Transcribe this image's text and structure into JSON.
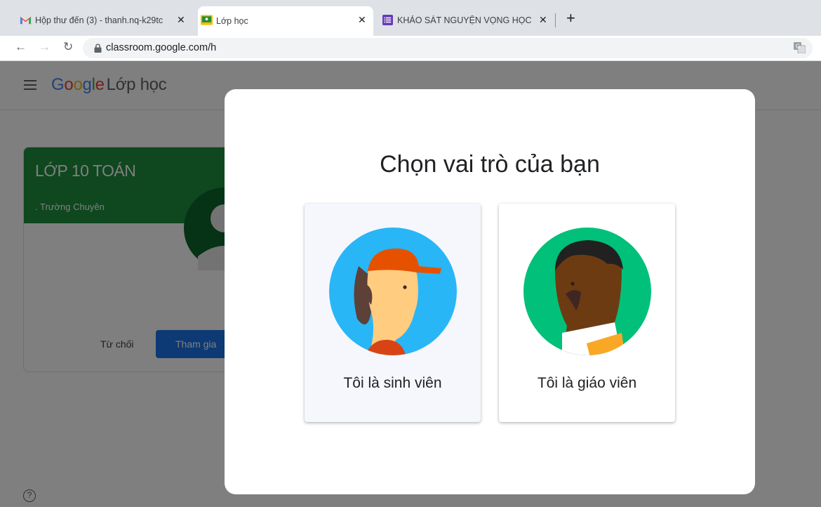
{
  "browser": {
    "tabs": [
      {
        "title": "Hộp thư đến (3) - thanh.nq-k29tc",
        "icon": "gmail-icon"
      },
      {
        "title": "Lớp học",
        "icon": "classroom-icon",
        "active": true
      },
      {
        "title": "KHẢO SÁT NGUYỆN VỌNG HỌC",
        "icon": "forms-icon"
      }
    ],
    "close_glyph": "✕",
    "new_tab_glyph": "+",
    "url": "classroom.google.com/h"
  },
  "app": {
    "logo_google": [
      "G",
      "o",
      "o",
      "g",
      "l",
      "e"
    ],
    "product_name": "Lớp học"
  },
  "class_card": {
    "title": "LỚP 10 TOÁN",
    "subtitle": ". Trường Chuyên",
    "decline_label": "Từ chối",
    "join_label": "Tham gia"
  },
  "help_glyph": "?",
  "dialog": {
    "title": "Chọn vai trò của bạn",
    "roles": [
      {
        "label": "Tôi là sinh viên",
        "illustration": "student-avatar-icon",
        "color": "#29b6f6"
      },
      {
        "label": "Tôi là giáo viên",
        "illustration": "teacher-avatar-icon",
        "color": "#00c07a"
      }
    ]
  },
  "colors": {
    "card_header": "#1e8e3e",
    "primary_button": "#1a73e8"
  }
}
